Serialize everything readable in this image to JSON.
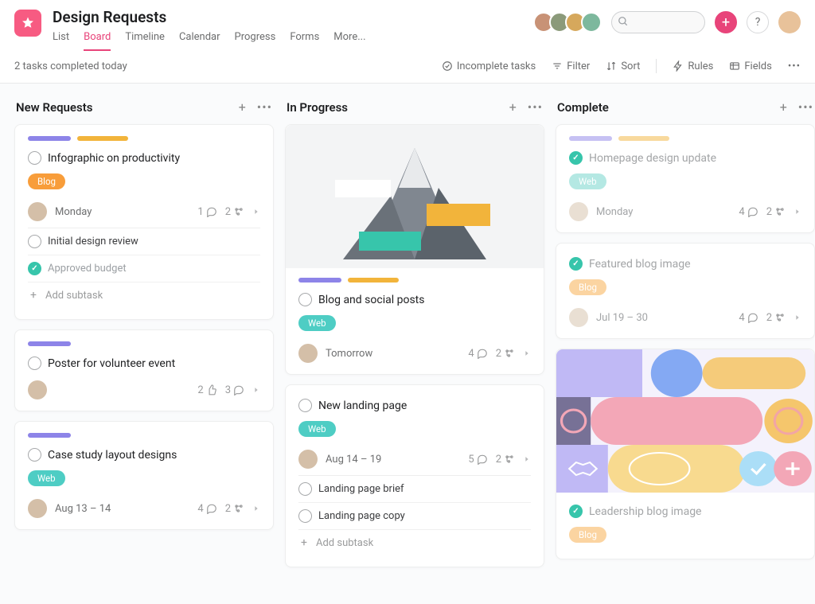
{
  "header": {
    "title": "Design Requests",
    "tabs": [
      {
        "label": "List",
        "active": false
      },
      {
        "label": "Board",
        "active": true
      },
      {
        "label": "Timeline",
        "active": false
      },
      {
        "label": "Calendar",
        "active": false
      },
      {
        "label": "Progress",
        "active": false
      },
      {
        "label": "Forms",
        "active": false
      },
      {
        "label": "More...",
        "active": false
      }
    ],
    "search_placeholder": "",
    "help_label": "?",
    "add_label": "+"
  },
  "toolbar": {
    "status_text": "2 tasks completed today",
    "filter_tasks": "Incomplete tasks",
    "filter": "Filter",
    "sort": "Sort",
    "rules": "Rules",
    "fields": "Fields"
  },
  "columns": [
    {
      "title": "New Requests",
      "cards": [
        {
          "stripes": [
            "purple",
            "yellow"
          ],
          "title": "Infographic on productivity",
          "tag": {
            "type": "blog",
            "label": "Blog"
          },
          "assignee": true,
          "date": "Monday",
          "metrics": {
            "comments": 1,
            "subtasks": 2
          },
          "subtasks": [
            {
              "done": false,
              "label": "Initial design review"
            },
            {
              "done": true,
              "label": "Approved budget"
            }
          ],
          "add_subtask": "Add subtask",
          "done": false
        },
        {
          "stripes": [
            "purple"
          ],
          "title": "Poster for volunteer event",
          "assignee": true,
          "metrics": {
            "likes": 2,
            "comments": 3
          },
          "done": false
        },
        {
          "stripes": [
            "purple"
          ],
          "title": "Case study layout designs",
          "tag": {
            "type": "web",
            "label": "Web"
          },
          "assignee": true,
          "date": "Aug 13 – 14",
          "metrics": {
            "comments": 4,
            "subtasks": 2
          },
          "done": false
        }
      ]
    },
    {
      "title": "In Progress",
      "cards": [
        {
          "cover": "mountain",
          "stripes": [
            "purple",
            "yellow"
          ],
          "title": "Blog and social posts",
          "tag": {
            "type": "web",
            "label": "Web"
          },
          "assignee": true,
          "date": "Tomorrow",
          "metrics": {
            "comments": 4,
            "subtasks": 2
          },
          "done": false
        },
        {
          "title": "New landing page",
          "tag": {
            "type": "web",
            "label": "Web"
          },
          "assignee": true,
          "date": "Aug 14 – 19",
          "metrics": {
            "comments": 5,
            "subtasks": 2
          },
          "subtasks": [
            {
              "done": false,
              "label": "Landing page brief"
            },
            {
              "done": false,
              "label": "Landing page copy"
            }
          ],
          "add_subtask": "Add subtask",
          "done": false
        }
      ]
    },
    {
      "title": "Complete",
      "cards": [
        {
          "stripes": [
            "purple",
            "yellow"
          ],
          "title": "Homepage design update",
          "tag": {
            "type": "web",
            "label": "Web",
            "faded": true
          },
          "assignee": true,
          "date": "Monday",
          "metrics": {
            "comments": 4,
            "subtasks": 2
          },
          "done": true,
          "dim": true
        },
        {
          "title": "Featured blog image",
          "tag": {
            "type": "blog",
            "label": "Blog",
            "faded": true
          },
          "assignee": true,
          "date": "Jul 19 – 30",
          "metrics": {
            "comments": 4,
            "subtasks": 2
          },
          "done": true,
          "dim": true
        },
        {
          "cover": "abstract",
          "title": "Leadership blog image",
          "tag": {
            "type": "blog",
            "label": "Blog",
            "faded": true
          },
          "done": true,
          "dim": true
        }
      ]
    }
  ],
  "avatar_colors": [
    "#c89276",
    "#8b9a7a",
    "#d6a85c",
    "#7db89d"
  ]
}
